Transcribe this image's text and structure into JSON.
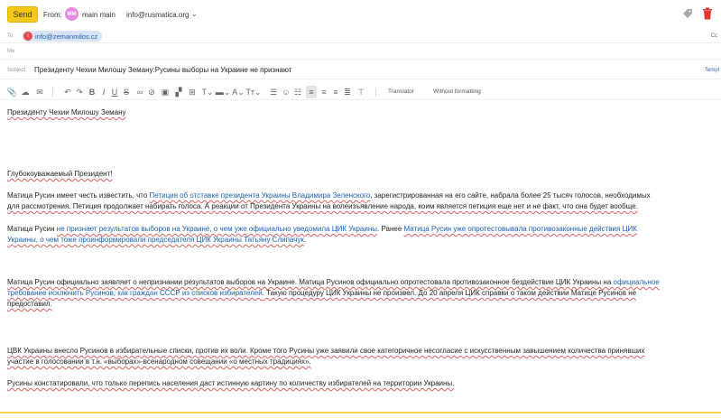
{
  "header": {
    "send_label": "Send",
    "from_label": "From:",
    "avatar_initials": "MM",
    "avatar_color": "#e58ce0",
    "from_name": "main main",
    "from_email": "info@rusmatica.org"
  },
  "to": {
    "label": "To",
    "recipient": "info@zemanmilos.cz",
    "recipient_initial": "i",
    "cc_label": "Cc"
  },
  "me": {
    "label": "Me"
  },
  "subject": {
    "label": "Subject",
    "value": "Президенту Чехии Милошу Земану:Русины выборы на Украине не признают",
    "templates_label": "Templ"
  },
  "toolbar": {
    "translator_label": "Translator",
    "without_formatting_label": "Without formatting"
  },
  "body": {
    "p1": "Президенту Чехии Милошу Земану",
    "p2": "Глубокоуважаемый Президент!",
    "p3a": "Матица Русин имеет честь известить, что ",
    "p3link": "Петиция об отставке президента Украины Владимира Зеленского",
    "p3b": ", зарегистрированная на его сайте, набрала более 25 тысяч голосов, необходимых",
    "p3c": "для рассмотрения. Петиция продолжает набирать голоса. А реакции от Президента Украины на волеизъявление народа, коим является петиция еще нет и не факт, что она будет вообще.",
    "p4a": "Матица Русин ",
    "p4link1": "не признает результатов выборов на Украине, о чем уже официально уведомила ЦИК Украины",
    "p4b": ". Ранее ",
    "p4link2": "Матица Русин уже опротестовывала противозаконные действия ЦИК",
    "p4link3": "Украины, о чем тоже проинформировали председателя ЦИК Украины Татьяну Слипачук",
    "p4c": ".",
    "p5a": "Матица Русин официально заявляет о непризнании результатов выборов на Украине. Матица Русинов официально опротестовала противозаконное бездействие ЦИК Украины на ",
    "p5link1": "официальное",
    "p5link2": "требование исключить Русинов, как граждан СССР из списков избирателей",
    "p5b": ". Такую процедуру ЦИК Украины не произвел. До 20 апреля ЦИК справки о таком действии Матице Русинов не",
    "p5c": "предоставил.",
    "p6a": "ЦВК Украины внесло Русинов в избирательные списки, против их воли. Кроме того Русины уже заявили свое категоричное несогласие с искусственным завышением количества принявших",
    "p6b": "участие в голосовании в т.н. «выборах»-всенародном совещании «о местных традициях».",
    "p7": "Русины констатировали, что только перепись населения даст истинную картину по количеству избирателей на территории Украины."
  },
  "colors": {
    "send_button": "#f6c816",
    "link": "#1a5fb4",
    "chip_bg": "#d8e4f6",
    "accent_line": "#f6d54a"
  }
}
